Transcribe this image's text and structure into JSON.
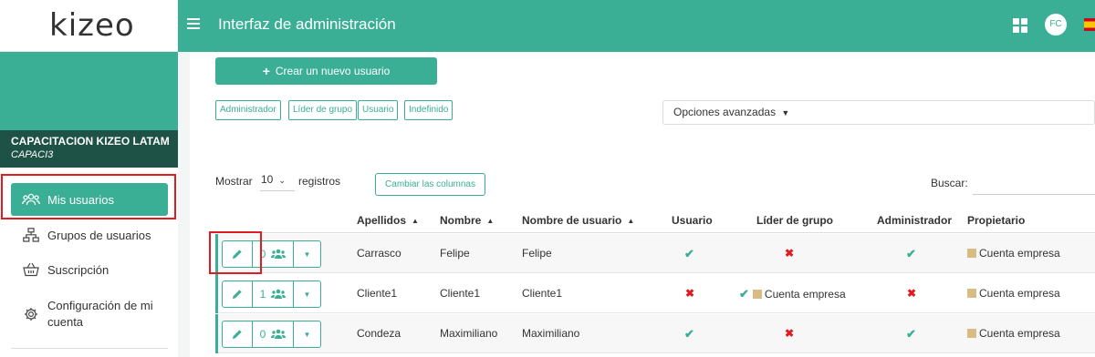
{
  "sidebar": {
    "logo": "kizeo",
    "account_name": "CAPACITACION KIZEO LATAM",
    "account_code": "CAPACI3",
    "items": [
      {
        "label": "Mis usuarios",
        "icon": "users-icon",
        "active": true
      },
      {
        "label": "Grupos de usuarios",
        "icon": "sitemap-icon"
      },
      {
        "label": "Suscripción",
        "icon": "basket-icon"
      },
      {
        "label": "Configuración de mi cuenta",
        "icon": "gear-icon"
      }
    ]
  },
  "topbar": {
    "title": "Interfaz de administración",
    "avatar_initials": "FC"
  },
  "main": {
    "create_button": "Crear un nuevo usuario",
    "filters": [
      "Administrador",
      "Líder de grupo",
      "Usuario",
      "Indefinido"
    ],
    "advanced_options": "Opciones avanzadas",
    "show_label": "Mostrar",
    "page_size": "10",
    "records_label": "registros",
    "columns_button": "Cambiar las columnas",
    "search_label": "Buscar:",
    "search_value": ""
  },
  "table": {
    "headers": [
      "Apellidos",
      "Nombre",
      "Nombre de usuario",
      "Usuario",
      "Líder de grupo",
      "Administrador",
      "Propietario"
    ],
    "rows": [
      {
        "count": "0",
        "apellidos": "Carrasco",
        "nombre": "Felipe",
        "usuario_nombre": "Felipe",
        "usuario": "check",
        "lider": "cross",
        "lider_text": "",
        "admin": "check",
        "propietario": "Cuenta empresa"
      },
      {
        "count": "1",
        "apellidos": "Cliente1",
        "nombre": "Cliente1",
        "usuario_nombre": "Cliente1",
        "usuario": "cross",
        "lider": "check",
        "lider_text": "Cuenta empresa",
        "admin": "cross",
        "propietario": "Cuenta empresa"
      },
      {
        "count": "0",
        "apellidos": "Condeza",
        "nombre": "Maximiliano",
        "usuario_nombre": "Maximiliano",
        "usuario": "check",
        "lider": "cross",
        "lider_text": "",
        "admin": "check",
        "propietario": "Cuenta empresa"
      }
    ]
  },
  "colors": {
    "accent": "#3aaf96",
    "dark_accent": "#1f5246",
    "highlight": "#e01b22",
    "owner_swatch": "#d9bc84"
  }
}
